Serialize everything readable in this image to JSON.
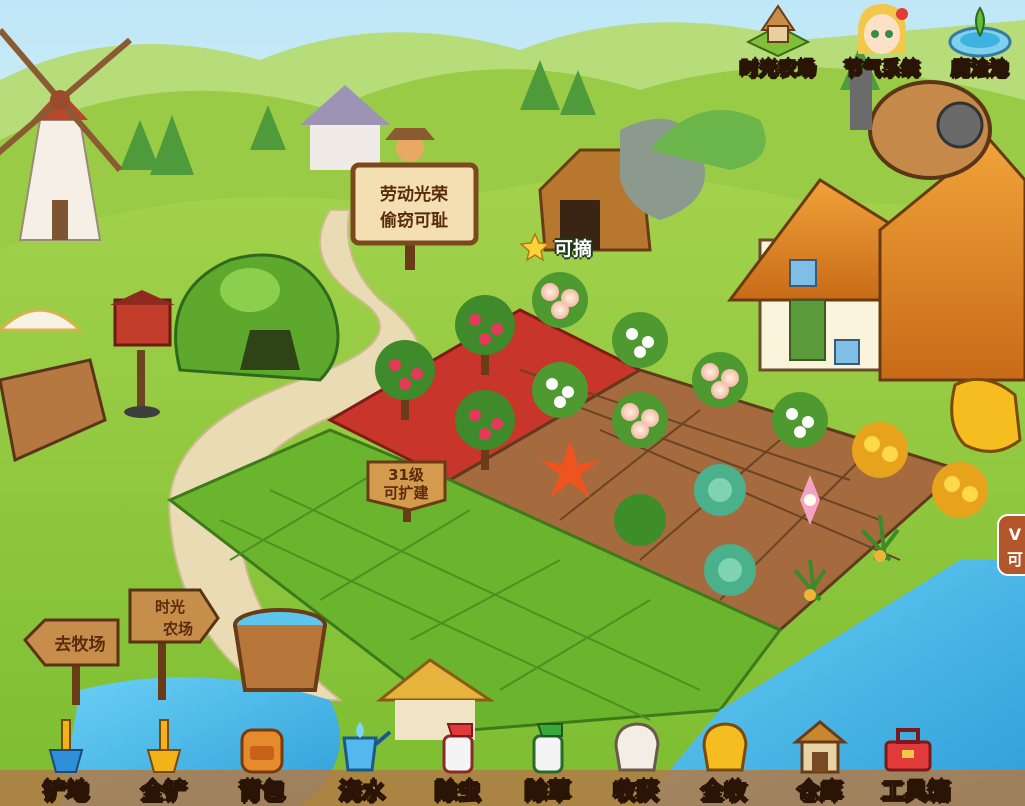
{
  "scene": {
    "scarecrow_sign": {
      "line1": "劳动光荣",
      "line2": "偷窃可耻"
    },
    "expand_sign": {
      "line1": "31级",
      "line2": "可扩建"
    },
    "pick_tag": {
      "label": "可摘"
    },
    "direction_signs": {
      "ranch": "去牧场",
      "time_farm_line1": "时光",
      "time_farm_line2": "农场"
    },
    "right_edge_badge": {
      "top": "V",
      "bottom": "可"
    }
  },
  "top_menu": [
    {
      "label": "时光农场",
      "icon": "time-farm-icon"
    },
    {
      "label": "节气系统",
      "icon": "solar-term-girl-icon"
    },
    {
      "label": "魔法池",
      "icon": "magic-pool-icon"
    }
  ],
  "toolbar": [
    {
      "label": "铲地",
      "icon": "shovel-icon"
    },
    {
      "label": "全铲",
      "icon": "all-shovel-icon"
    },
    {
      "label": "背包",
      "icon": "backpack-icon"
    },
    {
      "label": "浇水",
      "icon": "watering-can-icon"
    },
    {
      "label": "除虫",
      "icon": "pesticide-spray-icon"
    },
    {
      "label": "除草",
      "icon": "herbicide-spray-icon"
    },
    {
      "label": "收获",
      "icon": "harvest-hand-icon"
    },
    {
      "label": "全收",
      "icon": "harvest-all-hand-icon"
    },
    {
      "label": "仓库",
      "icon": "warehouse-icon"
    },
    {
      "label": "工具箱",
      "icon": "toolbox-icon"
    }
  ],
  "colors": {
    "sky": "#9fd8f2",
    "grass": "#8cc63e",
    "soil": "#a56a3e",
    "red_soil": "#c8352b",
    "water": "#4fb8e8"
  }
}
